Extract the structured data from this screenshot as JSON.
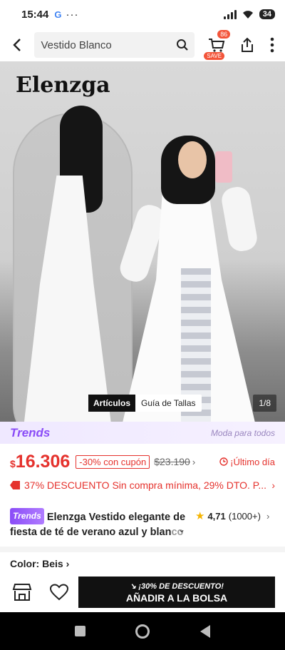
{
  "status_bar": {
    "time": "15:44",
    "app_indicator": "G",
    "dots": "···",
    "battery": "34"
  },
  "search": {
    "value": "Vestido Blanco"
  },
  "cart": {
    "badge": "86",
    "save_label": "SAVE"
  },
  "hero": {
    "brand": "Elenzga",
    "tab_articles": "Artículos",
    "tab_size_guide": "Guía de Tallas",
    "counter": "1/8"
  },
  "trends": {
    "logo": "Trends",
    "slogan": "Moda para todos"
  },
  "price": {
    "currency": "$",
    "current": "16.306",
    "discount": "-30% con cupón",
    "original": "$23.190",
    "deadline": "¡Último día"
  },
  "promo": {
    "text": "37% DESCUENTO Sin compra mínima,  29% DTO. P..."
  },
  "product": {
    "badge": "Trends",
    "title_main": "Elenzga Vestido elegante de fiesta de té de verano azul y blan",
    "title_fade": "co",
    "rating": "4,71",
    "reviews": "(1000+)"
  },
  "color": {
    "label": "Color: Beis"
  },
  "actions": {
    "add_to_bag_promo": "¡30% DE DESCUENTO!",
    "add_to_bag": "AÑADIR A LA BOLSA"
  },
  "colors": {
    "accent": "#e5322d",
    "trends": "#8a4cf7",
    "cart_badge": "#f3553a"
  }
}
